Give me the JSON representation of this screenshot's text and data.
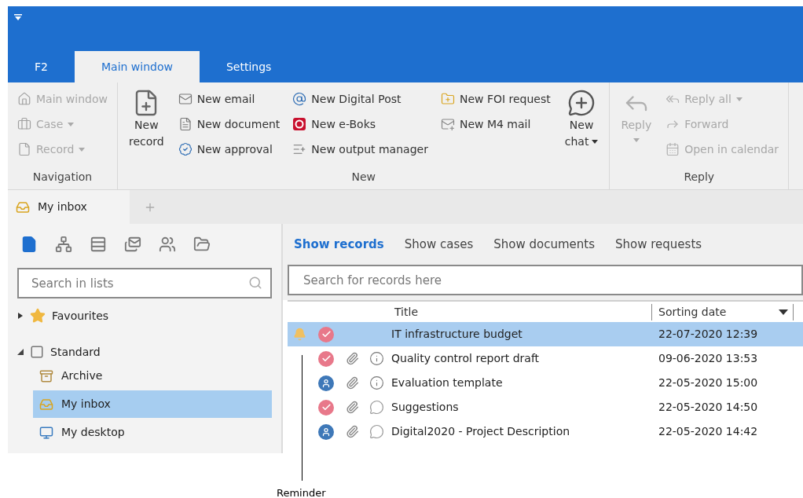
{
  "app_tabs": [
    {
      "label": "F2",
      "selected": false
    },
    {
      "label": "Main window",
      "selected": true
    },
    {
      "label": "Settings",
      "selected": false
    }
  ],
  "ribbon": [
    {
      "label": "Navigation",
      "items": [
        {
          "kind": "small",
          "label": "Main window",
          "disabled": true,
          "dropdown": false
        },
        {
          "kind": "small",
          "label": "Case",
          "disabled": true,
          "dropdown": true
        },
        {
          "kind": "small",
          "label": "Record",
          "disabled": true,
          "dropdown": true
        }
      ]
    },
    {
      "label": "New",
      "items": [
        {
          "kind": "large",
          "lines": [
            "New",
            "record"
          ],
          "disabled": false,
          "dropdown": false
        },
        {
          "kind": "small",
          "label": "New email",
          "disabled": false,
          "dropdown": false
        },
        {
          "kind": "small",
          "label": "New document",
          "disabled": false,
          "dropdown": false
        },
        {
          "kind": "small",
          "label": "New approval",
          "disabled": false,
          "dropdown": false
        },
        {
          "kind": "small",
          "label": "New Digital Post",
          "disabled": false,
          "dropdown": false
        },
        {
          "kind": "small",
          "label": "New e-Boks",
          "disabled": false,
          "dropdown": false
        },
        {
          "kind": "small",
          "label": "New output manager",
          "disabled": false,
          "dropdown": false
        },
        {
          "kind": "small",
          "label": "New FOI request",
          "disabled": false,
          "dropdown": false
        },
        {
          "kind": "small",
          "label": "New M4 mail",
          "disabled": false,
          "dropdown": false
        },
        {
          "kind": "large",
          "lines": [
            "New",
            "chat"
          ],
          "disabled": false,
          "dropdown": true
        }
      ]
    },
    {
      "label": "Reply",
      "items": [
        {
          "kind": "large",
          "lines": [
            "Reply"
          ],
          "disabled": true,
          "dropdown": true
        },
        {
          "kind": "small",
          "label": "Reply all",
          "disabled": true,
          "dropdown": true
        },
        {
          "kind": "small",
          "label": "Forward",
          "disabled": true,
          "dropdown": false
        },
        {
          "kind": "small",
          "label": "Open in calendar",
          "disabled": true,
          "dropdown": false
        }
      ]
    }
  ],
  "doc_tabs": [
    {
      "label": "My inbox",
      "selected": true
    }
  ],
  "list_types": [
    {
      "selected": true
    },
    {
      "selected": false
    },
    {
      "selected": false
    },
    {
      "selected": false
    },
    {
      "selected": false
    },
    {
      "selected": false
    }
  ],
  "list_search": {
    "placeholder": "Search in lists"
  },
  "tree": [
    {
      "label": "Favourites",
      "expanded": false,
      "selected": false
    },
    {
      "label": "Standard",
      "expanded": true,
      "selected": false,
      "children": [
        {
          "label": "Archive",
          "selected": false
        },
        {
          "label": "My inbox",
          "selected": true
        },
        {
          "label": "My desktop",
          "selected": false
        }
      ]
    }
  ],
  "view_tabs": [
    {
      "label": "Show records",
      "selected": true
    },
    {
      "label": "Show cases",
      "selected": false
    },
    {
      "label": "Show documents",
      "selected": false
    },
    {
      "label": "Show requests",
      "selected": false
    }
  ],
  "record_search": {
    "placeholder": "Search for records here"
  },
  "table": {
    "columns": [
      {
        "label": "Title",
        "sorted": false
      },
      {
        "label": "Sorting date",
        "sorted": true
      }
    ],
    "rows": [
      {
        "title": "IT infrastructure budget",
        "date": "22-07-2020 12:39",
        "selected": true,
        "reminder": true,
        "approved": true,
        "attachment": false,
        "info": false,
        "comment": false
      },
      {
        "title": "Quality control report draft",
        "date": "09-06-2020 13:53",
        "selected": false,
        "reminder": false,
        "approved": true,
        "attachment": true,
        "info": true,
        "comment": false
      },
      {
        "title": "Evaluation template",
        "date": "22-05-2020 15:00",
        "selected": false,
        "reminder": false,
        "approved": false,
        "attachment": true,
        "info": true,
        "comment": false
      },
      {
        "title": "Suggestions",
        "date": "22-05-2020 14:50",
        "selected": false,
        "reminder": false,
        "approved": true,
        "attachment": true,
        "info": false,
        "comment": true
      },
      {
        "title": "Digital2020 - Project Description",
        "date": "22-05-2020 14:42",
        "selected": false,
        "reminder": false,
        "approved": false,
        "attachment": true,
        "info": false,
        "comment": true
      }
    ]
  },
  "callout": {
    "label": "Reminder"
  }
}
